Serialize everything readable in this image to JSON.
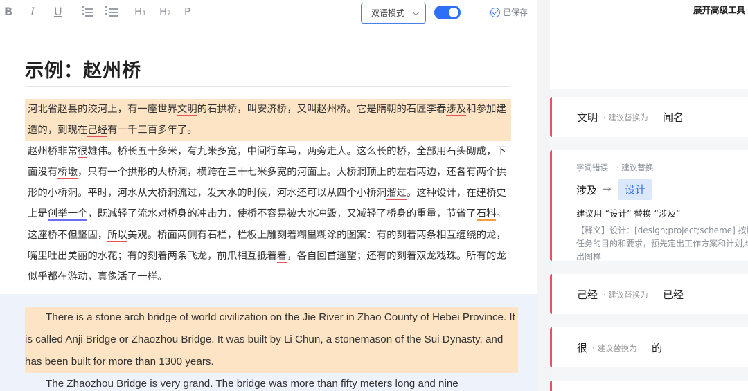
{
  "toolbar": {
    "bold_label": "B",
    "italic_label": "I",
    "underline_label": "U",
    "heading1_label": "H",
    "heading1_sub": "1",
    "heading2_label": "H",
    "heading2_sub": "2",
    "paragraph_label": "P",
    "mode_select_value": "双语模式",
    "bilingual_toggle_on": true,
    "saved_label": "已保存",
    "accent_color": "#2f6ff5"
  },
  "doc": {
    "title": "示例：赵州桥",
    "cn_paragraphs": [
      {
        "highlight": true,
        "segments": [
          {
            "t": "河北省赵县的洨河上，有一座世界"
          },
          {
            "t": "文明",
            "err": "r"
          },
          {
            "t": "的石拱桥，叫安济桥，又叫赵州桥。它是隋朝的石匠李春"
          },
          {
            "t": "涉及",
            "err": "r"
          },
          {
            "t": "和参加建造的，到现在"
          },
          {
            "t": "己经",
            "err": "r"
          },
          {
            "t": "有一千三百多年了。"
          }
        ]
      },
      {
        "highlight": false,
        "segments": [
          {
            "t": "赵州桥非常"
          },
          {
            "t": "很",
            "err": "r"
          },
          {
            "t": "雄伟。桥长五十多米，有九米多宽，中间行车马，两旁走人。这么长的桥，全部用石头砌成，下面没有"
          },
          {
            "t": "桥墩",
            "err": "r"
          },
          {
            "t": "，只有一个拱形的大桥洞，横跨在三十七米多宽的河面上。大桥洞顶上的左右两边，还各有两个拱形的小桥洞。平时，河水从大桥洞流过，发大水的时候，河水还可以从四个小桥洞"
          },
          {
            "t": "溜过",
            "err": "r"
          },
          {
            "t": "。这种设计，在建桥史上是"
          },
          {
            "t": "创举一个",
            "err": "b"
          },
          {
            "t": "，既减轻了流水对桥身的冲击力，使桥不容易被大水冲毁，又减轻了桥身的重量，节省了"
          },
          {
            "t": "石料",
            "err": "o"
          },
          {
            "t": "。"
          }
        ]
      },
      {
        "highlight": false,
        "segments": [
          {
            "t": "这座桥不但坚固，"
          },
          {
            "t": "所以",
            "err": "r"
          },
          {
            "t": "美观。桥面两侧有石栏，栏板上雕刻着糊里糊涂的图案：有的刻着两条相互缠绕的龙，嘴里吐出美丽的水花；有的刻着两条飞龙，前爪相互抵着"
          },
          {
            "t": "着",
            "err": "r"
          },
          {
            "t": "，各自回首遥望；还有的刻着双龙戏珠。所有的龙似乎都在游动，真像活了一样。"
          }
        ]
      }
    ],
    "en_paragraphs": [
      {
        "highlight": true,
        "text": "There is a stone arch bridge of world civilization on the Jie River in Zhao County of Hebei Province. It is called Anji Bridge or Zhaozhou Bridge. It was built by Li Chun, a stonemason of the Sui Dynasty, and has been built for more than 1300 years."
      },
      {
        "highlight": false,
        "text": "The Zhaozhou Bridge is very grand. The bridge was more than fifty meters long and nine"
      }
    ]
  },
  "panel": {
    "advanced_tools_label": "展开高级工具",
    "error_color": "#e5545b",
    "cards": [
      {
        "word": "文明",
        "hint": "· 建议替换为",
        "replacement": "闻名"
      },
      {
        "type_label": "字词错误",
        "action_label": "· 建议替换",
        "from_word": "涉及",
        "arrow": "→",
        "to_word": "设计",
        "suggestion_text": "建议用 “设计” 替换 “涉及”",
        "definition": "【释义】设计：[design;project;scheme] 按照任务的目的和要求，预先定出工作方案和计划,绘出图样"
      },
      {
        "word": "己经",
        "hint": "· 建议替换为",
        "replacement": "已经"
      },
      {
        "word": "很",
        "hint": "· 建议替换为",
        "replacement": "的"
      }
    ]
  }
}
